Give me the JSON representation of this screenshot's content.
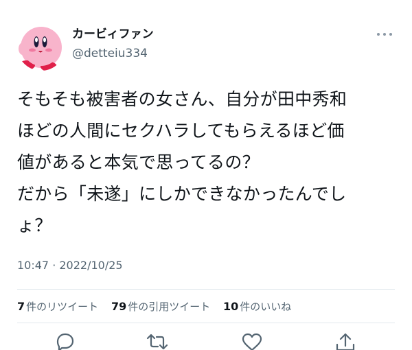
{
  "tweet": {
    "display_name": "カービィファン",
    "handle": "@detteiu334",
    "text_lines": [
      "そもそも被害者の女さん、自分が田中秀和",
      "ほどの人間にセクハラしてもらえるほど価",
      "値があると本気で思ってるの？",
      "だから「未遂」にしかできなかったんでし",
      "ょ？"
    ],
    "timestamp": "10:47 · 2022/10/25",
    "stats": {
      "retweets": {
        "count": "7",
        "label": "件のリツイート"
      },
      "quotes": {
        "count": "79",
        "label": "件の引用ツイート"
      },
      "likes": {
        "count": "10",
        "label": "件のいいね"
      }
    }
  },
  "icons": {
    "avatar": "kirby-avatar",
    "more": "more-horizontal-icon",
    "reply": "reply-icon",
    "retweet": "retweet-icon",
    "like": "heart-icon",
    "share": "share-icon"
  },
  "colors": {
    "text": "#0f1419",
    "secondary": "#536471",
    "divider": "#e1e8ed",
    "avatar_pink": "#f6a6c1"
  }
}
